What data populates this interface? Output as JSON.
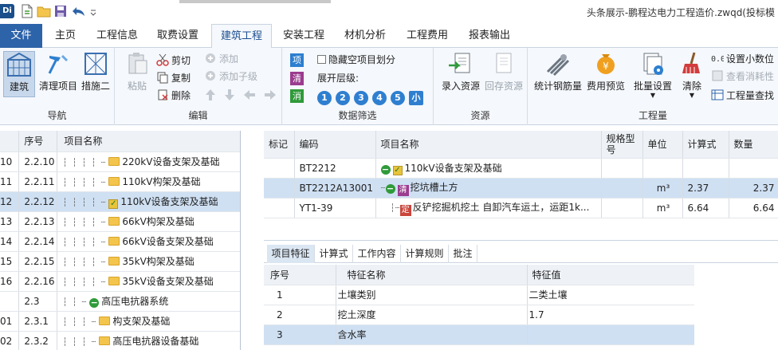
{
  "titlebar": {
    "logo": "Di",
    "title": "头条展示-鹏程达电力工程造价.zwqd(投标模"
  },
  "tabs": [
    {
      "label": "文件"
    },
    {
      "label": "主页"
    },
    {
      "label": "工程信息"
    },
    {
      "label": "取费设置"
    },
    {
      "label": "建筑工程"
    },
    {
      "label": "安装工程"
    },
    {
      "label": "材机分析"
    },
    {
      "label": "工程费用"
    },
    {
      "label": "报表输出"
    }
  ],
  "ribbon": {
    "nav": {
      "title": "导航",
      "jianzhu": "建筑",
      "qingli": "清理项目",
      "cuoshi": "措施二"
    },
    "edit": {
      "title": "编辑",
      "paste": "粘贴",
      "cut": "剪切",
      "copy": "复制",
      "delete": "删除",
      "add": "添加",
      "add_child": "添加子级"
    },
    "filter": {
      "title": "数据筛选",
      "xiang": "项",
      "qing": "清",
      "xiao": "消",
      "hide_empty": "隐藏空项目划分",
      "expand_level": "展开层级:",
      "levels": [
        "1",
        "2",
        "3",
        "4",
        "5",
        "小"
      ]
    },
    "resource": {
      "title": "资源",
      "input": "录入资源",
      "backfill": "回存资源"
    },
    "quantity": {
      "title": "工程量",
      "steel": "统计钢筋量",
      "fee": "费用预览",
      "batch": "批量设置",
      "clear": "清除",
      "decimal": "设置小数位",
      "loss": "查看消耗性",
      "search": "工程量查找"
    }
  },
  "tree": {
    "headers": {
      "seq": "序号",
      "name": "项目名称"
    },
    "rows": [
      {
        "idx": "10",
        "seq": "2.2.10",
        "name": "220kV设备支架及基础"
      },
      {
        "idx": "11",
        "seq": "2.2.11",
        "name": "110kV构架及基础"
      },
      {
        "idx": "12",
        "seq": "2.2.12",
        "name": "110kV设备支架及基础"
      },
      {
        "idx": "13",
        "seq": "2.2.13",
        "name": "66kV构架及基础"
      },
      {
        "idx": "14",
        "seq": "2.2.14",
        "name": "66kV设备支架及基础"
      },
      {
        "idx": "15",
        "seq": "2.2.15",
        "name": "35kV构架及基础"
      },
      {
        "idx": "16",
        "seq": "2.2.16",
        "name": "35kV设备支架及基础"
      },
      {
        "idx": "",
        "seq": "2.3",
        "name": "高压电抗器系统"
      },
      {
        "idx": "01",
        "seq": "2.3.1",
        "name": "构支架及基础"
      },
      {
        "idx": "02",
        "seq": "2.3.2",
        "name": "高压电抗器设备基础"
      }
    ]
  },
  "grid": {
    "headers": {
      "mark": "标记",
      "code": "编码",
      "name": "项目名称",
      "spec": "规格型号",
      "unit": "单位",
      "formula": "计算式",
      "qty": "数量"
    },
    "rows": [
      {
        "mark": "",
        "code": "BT2212",
        "name": "110kV设备支架及基础",
        "spec": "",
        "unit": "",
        "formula": "",
        "qty": ""
      },
      {
        "mark": "",
        "code": "BT2212A13001",
        "badge": "清",
        "name": "挖坑槽土方",
        "spec": "",
        "unit": "m³",
        "formula": "2.37",
        "qty": "2.37"
      },
      {
        "mark": "",
        "code": "YT1-39",
        "badge": "定",
        "name": "反铲挖掘机挖土 自卸汽车运土，运距1k...",
        "spec": "",
        "unit": "m³",
        "formula": "6.64",
        "qty": "6.64"
      }
    ]
  },
  "subtabs": [
    {
      "label": "项目特征"
    },
    {
      "label": "计算式"
    },
    {
      "label": "工作内容"
    },
    {
      "label": "计算规则"
    },
    {
      "label": "批注"
    }
  ],
  "features": {
    "headers": {
      "seq": "序号",
      "name": "特征名称",
      "value": "特征值"
    },
    "rows": [
      {
        "seq": "1",
        "name": "土壤类别",
        "value": "二类土壤"
      },
      {
        "seq": "2",
        "name": "挖土深度",
        "value": "1.7"
      },
      {
        "seq": "3",
        "name": "含水率",
        "value": ""
      }
    ]
  }
}
